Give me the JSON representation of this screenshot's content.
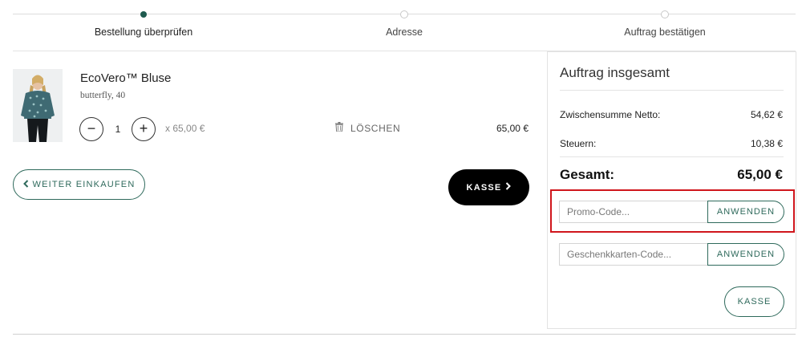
{
  "steps": [
    {
      "label": "Bestellung überprüfen",
      "active": true
    },
    {
      "label": "Adresse",
      "active": false
    },
    {
      "label": "Auftrag bestätigen",
      "active": false
    }
  ],
  "item": {
    "name": "EcoVero™ Bluse",
    "variant": "butterfly, 40",
    "quantity": "1",
    "unit_price": "x 65,00 €",
    "delete_label": "LÖSCHEN",
    "line_total": "65,00 €",
    "minus_symbol": "−",
    "plus_symbol": "+"
  },
  "actions": {
    "continue_label": "WEITER EINKAUFEN",
    "checkout_label": "KASSE"
  },
  "summary": {
    "title": "Auftrag insgesamt",
    "subtotal_label": "Zwischensumme Netto:",
    "subtotal_value": "54,62 €",
    "tax_label": "Steuern:",
    "tax_value": "10,38 €",
    "total_label": "Gesamt:",
    "total_value": "65,00 €",
    "promo_placeholder": "Promo-Code...",
    "promo_apply": "ANWENDEN",
    "giftcard_placeholder": "Geschenkkarten-Code...",
    "giftcard_apply": "ANWENDEN",
    "checkout_label": "KASSE"
  },
  "colors": {
    "accent": "#2f6a5c",
    "step_active": "#1e5a4e",
    "highlight": "#d0161c"
  },
  "icons": [
    "chevron-left-icon",
    "chevron-right-icon",
    "trash-icon"
  ]
}
